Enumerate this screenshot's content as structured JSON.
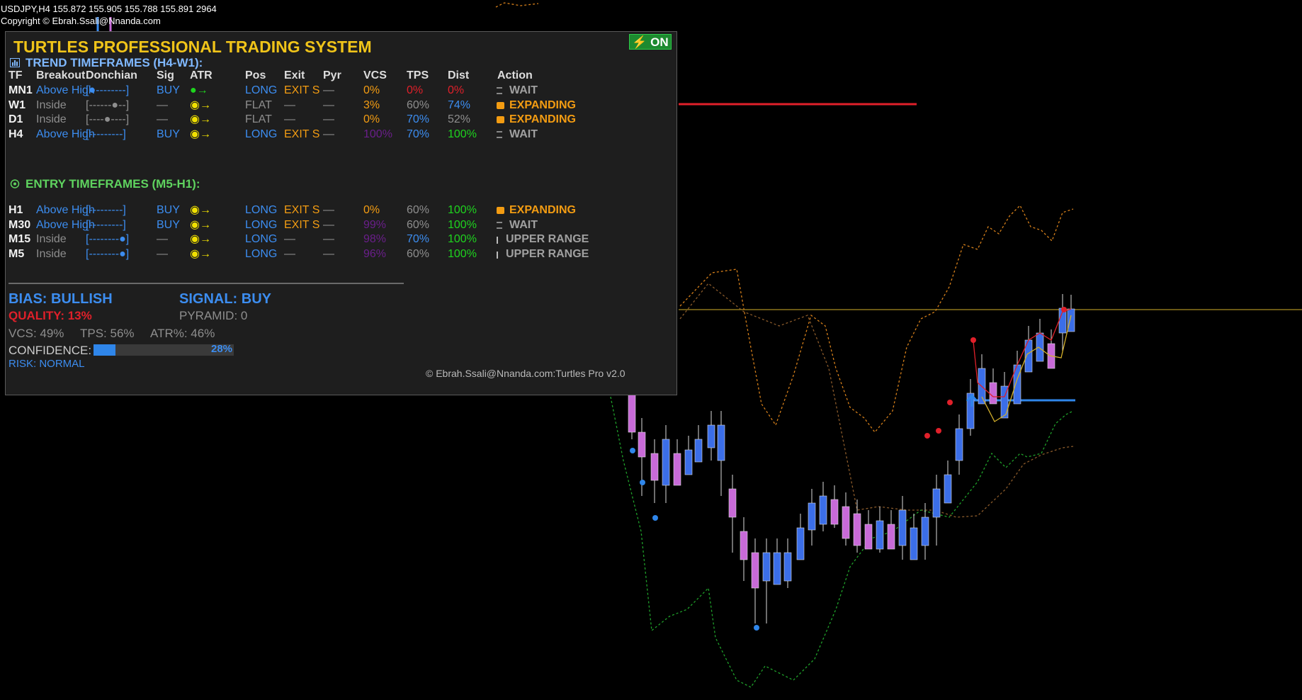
{
  "chart_header": {
    "line1": "USDJPY,H4  155.872 155.905 155.788 155.891  2964",
    "line2": "Copyright © Ebrah.Ssali@Nnanda.com"
  },
  "panel": {
    "title": "TURTLES PROFESSIONAL TRADING SYSTEM",
    "on_button": "⚡ ON",
    "trend_section": "TREND TIMEFRAMES (H4-W1):",
    "entry_section": "ENTRY TIMEFRAMES (M5-H1):",
    "columns": [
      "TF",
      "Breakout",
      "Donchian",
      "Sig",
      "ATR",
      "Pos",
      "Exit",
      "Pyr",
      "VCS",
      "TPS",
      "Dist",
      "Action"
    ],
    "trend_rows": [
      {
        "tf": "MN1",
        "breakout": "Above High",
        "donchian": "[●--------]",
        "sig": "BUY",
        "atr": "●→",
        "pos": "LONG",
        "exit": "EXIT S",
        "pyr": "—",
        "vcs": "0%",
        "tps": "0%",
        "dist": "0%",
        "action": "WAIT"
      },
      {
        "tf": "W1",
        "breakout": "Inside",
        "donchian": "[------●--]",
        "sig": "—",
        "atr": "◉→",
        "pos": "FLAT",
        "exit": "—",
        "pyr": "—",
        "vcs": "3%",
        "tps": "60%",
        "dist": "74%",
        "action": "EXPANDING"
      },
      {
        "tf": "D1",
        "breakout": "Inside",
        "donchian": "[----●----]",
        "sig": "—",
        "atr": "◉→",
        "pos": "FLAT",
        "exit": "—",
        "pyr": "—",
        "vcs": "0%",
        "tps": "70%",
        "dist": "52%",
        "action": "EXPANDING"
      },
      {
        "tf": "H4",
        "breakout": "Above High",
        "donchian": "[---------]",
        "sig": "BUY",
        "atr": "◉→",
        "pos": "LONG",
        "exit": "EXIT S",
        "pyr": "—",
        "vcs": "100%",
        "tps": "70%",
        "dist": "100%",
        "action": "WAIT"
      }
    ],
    "entry_rows": [
      {
        "tf": "H1",
        "breakout": "Above High",
        "donchian": "[---------]",
        "sig": "BUY",
        "atr": "◉→",
        "pos": "LONG",
        "exit": "EXIT S",
        "pyr": "—",
        "vcs": "0%",
        "tps": "60%",
        "dist": "100%",
        "action": "EXPANDING"
      },
      {
        "tf": "M30",
        "breakout": "Above High",
        "donchian": "[---------]",
        "sig": "BUY",
        "atr": "◉→",
        "pos": "LONG",
        "exit": "EXIT S",
        "pyr": "—",
        "vcs": "99%",
        "tps": "60%",
        "dist": "100%",
        "action": "WAIT"
      },
      {
        "tf": "M15",
        "breakout": "Inside",
        "donchian": "[--------●]",
        "sig": "—",
        "atr": "◉→",
        "pos": "LONG",
        "exit": "—",
        "pyr": "—",
        "vcs": "98%",
        "tps": "70%",
        "dist": "100%",
        "action": "UPPER RANGE"
      },
      {
        "tf": "M5",
        "breakout": "Inside",
        "donchian": "[--------●]",
        "sig": "—",
        "atr": "◉→",
        "pos": "LONG",
        "exit": "—",
        "pyr": "—",
        "vcs": "96%",
        "tps": "60%",
        "dist": "100%",
        "action": "UPPER RANGE"
      }
    ],
    "bias": "BIAS: BULLISH",
    "signal": "SIGNAL: BUY",
    "quality": "QUALITY: 13%",
    "pyramid": "PYRAMID: 0",
    "vcs": "VCS: 49%",
    "tps": "TPS: 56%",
    "atr": "ATR%: 46%",
    "confidence_label": "CONFIDENCE:",
    "confidence_pct": "28%",
    "confidence_value": 0.28,
    "risk": "RISK: NORMAL",
    "footer": "© Ebrah.Ssali@Nnanda.com:Turtles Pro v2.0"
  },
  "colors": {
    "bull": "#3b6ee8",
    "bear": "#c86ad8",
    "accent": "#f0c419",
    "signal_red": "#e0202a"
  }
}
